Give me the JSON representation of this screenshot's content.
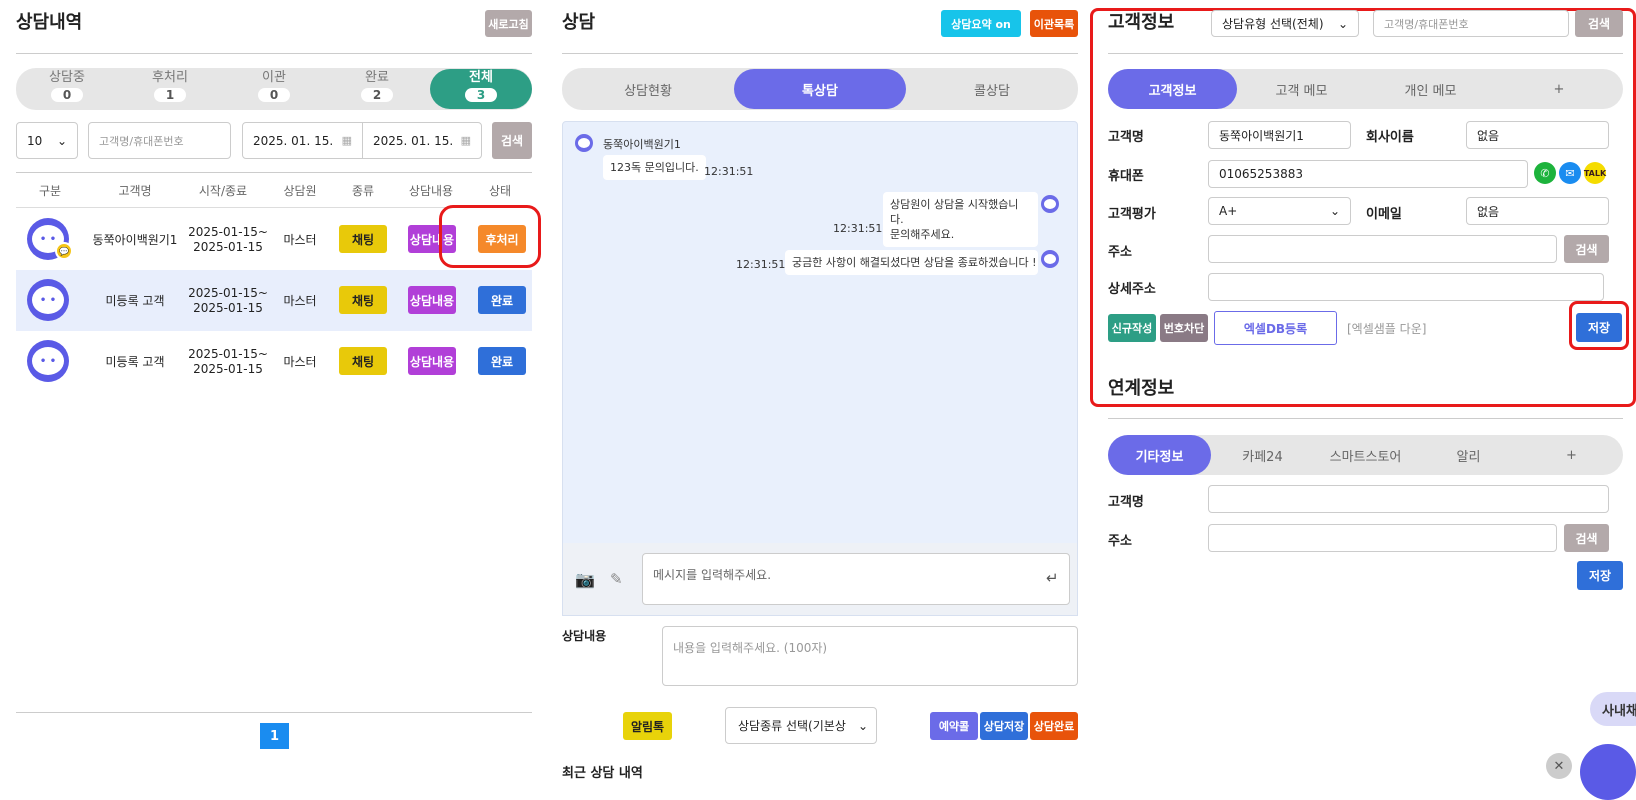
{
  "left": {
    "title": "상담내역",
    "refresh": "새로고침",
    "status_tabs": [
      {
        "label": "상담중",
        "count": "0"
      },
      {
        "label": "후처리",
        "count": "1"
      },
      {
        "label": "이관",
        "count": "0"
      },
      {
        "label": "완료",
        "count": "2"
      },
      {
        "label": "전체",
        "count": "3"
      }
    ],
    "page_size": "10",
    "search_placeholder": "고객명/휴대폰번호",
    "date_from": "2025. 01. 15.",
    "date_to": "2025. 01. 15.",
    "search_button": "검색",
    "columns": [
      "구분",
      "고객명",
      "시작/종료",
      "상담원",
      "종류",
      "상담내용",
      "상태"
    ],
    "rows": [
      {
        "name": "동쭉아이백원기1",
        "start": "2025-01-15~",
        "end": "2025-01-15",
        "agent": "마스터",
        "kind": "채팅",
        "content": "상담내용",
        "status": "후처리"
      },
      {
        "name": "미등록 고객",
        "start": "2025-01-15~",
        "end": "2025-01-15",
        "agent": "마스터",
        "kind": "채팅",
        "content": "상담내용",
        "status": "완료"
      },
      {
        "name": "미등록 고객",
        "start": "2025-01-15~",
        "end": "2025-01-15",
        "agent": "마스터",
        "kind": "채팅",
        "content": "상담내용",
        "status": "완료"
      }
    ],
    "page": "1"
  },
  "middle": {
    "title": "상담",
    "summary_btn": "상담요약 on",
    "transfer_btn": "이관목록",
    "tabs": [
      "상담현황",
      "톡상담",
      "콜상담"
    ],
    "chat_sender": "동쭉아이백원기1",
    "messages": [
      {
        "text": "123독 문의입니다.",
        "time": "12:31:51"
      },
      {
        "text1": "상담원이 상담을 시작했습니다.",
        "text2": "문의해주세요.",
        "time": "12:31:51"
      },
      {
        "text": "궁금한 사항이 해결되셨다면 상담을 종료하겠습니다 !",
        "time": "12:31:51"
      }
    ],
    "msg_placeholder": "메시지를 입력해주세요.",
    "content_label": "상담내용",
    "content_placeholder": "내용을 입력해주세요. (100자)",
    "alimtalk": "알림톡",
    "kind_select": "상담종류 선택(기본상",
    "reserve": "예약콜",
    "save": "상담저장",
    "complete": "상담완료",
    "recent": "최근 상담 내역"
  },
  "right": {
    "title": "고객정보",
    "type_select": "상담유형 선택(전체)",
    "search_placeholder": "고객명/휴대폰번호",
    "search_button": "검색",
    "tabs": [
      "고객정보",
      "고객 메모",
      "개인 메모",
      "+"
    ],
    "name_label": "고객명",
    "name_value": "동쭉아이백원기1",
    "company_label": "회사이름",
    "company_value": "없음",
    "phone_label": "휴대폰",
    "phone_value": "01065253883",
    "grade_label": "고객평가",
    "grade_value": "A+",
    "email_label": "이메일",
    "email_value": "없음",
    "addr_label": "주소",
    "addr_search": "검색",
    "detail_label": "상세주소",
    "new_btn": "신규작성",
    "block_btn": "번호차단",
    "excel_btn": "엑셀DB등록",
    "excel_sample": "[엑셀샘플 다운]",
    "save_btn": "저장",
    "linked_title": "연계정보",
    "linked_tabs": [
      "기타정보",
      "카페24",
      "스마트스토어",
      "알리",
      "+"
    ],
    "l_name_label": "고객명",
    "l_addr_label": "주소",
    "l_search": "검색",
    "l_save": "저장",
    "internal_chat": "사내채"
  }
}
